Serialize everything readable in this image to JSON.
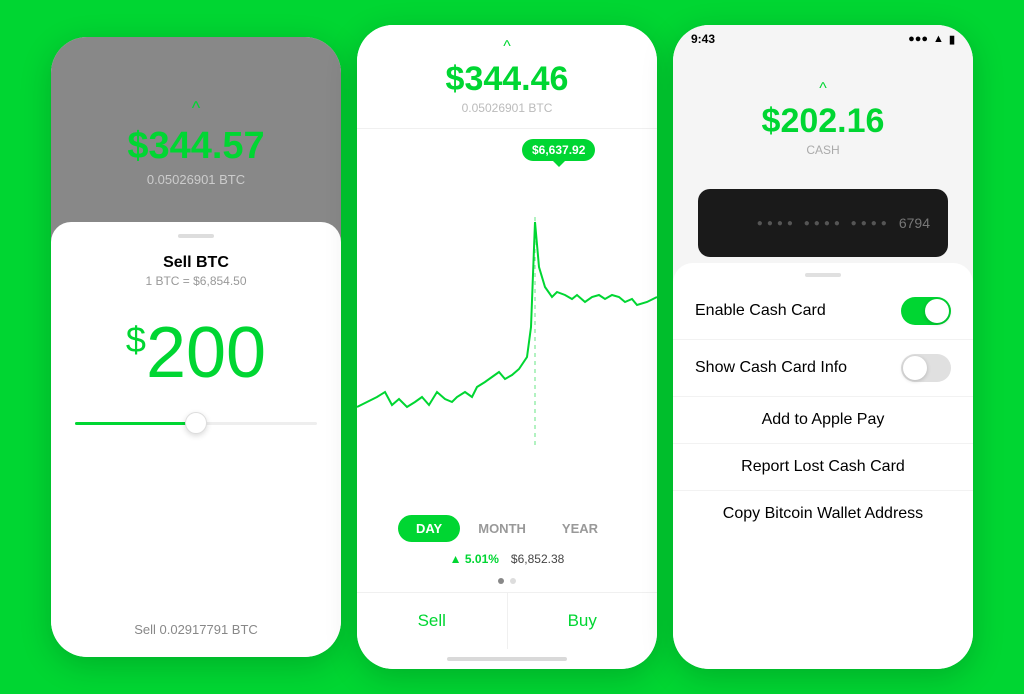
{
  "screens": {
    "phone1": {
      "top": {
        "caret": "^",
        "amount": "$344.57",
        "sub": "0.05026901 BTC"
      },
      "sheet": {
        "title": "Sell BTC",
        "rate": "1 BTC = $6,854.50",
        "amount": "$200",
        "amount_dollar": "$",
        "amount_number": "200",
        "bottom_label": "Sell 0.02917791 BTC"
      }
    },
    "phone2": {
      "top": {
        "caret": "^",
        "amount": "$344.46",
        "sub": "0.05026901 BTC"
      },
      "chart": {
        "tooltip": "$6,637.92"
      },
      "periods": [
        {
          "label": "DAY",
          "active": true
        },
        {
          "label": "MONTH",
          "active": false
        },
        {
          "label": "YEAR",
          "active": false
        }
      ],
      "stats": {
        "pct": "▲ 5.01%",
        "value": "$6,852.38"
      },
      "actions": {
        "sell": "Sell",
        "buy": "Buy"
      }
    },
    "phone3": {
      "statusBar": {
        "time": "9:43",
        "signal": "▲ ●●●",
        "wifi": "wifi",
        "battery": "■"
      },
      "top": {
        "caret": "^",
        "amount": "$202.16",
        "sub": "CASH"
      },
      "card": {
        "dots": "●●●● ●●●● ●●●●",
        "number": "6794"
      },
      "sheet": {
        "handle": "",
        "rows": [
          {
            "label": "Enable Cash Card",
            "type": "toggle",
            "value": true
          },
          {
            "label": "Show Cash Card Info",
            "type": "toggle",
            "value": false
          },
          {
            "label": "Add to Apple Pay",
            "type": "action"
          },
          {
            "label": "Report Lost Cash Card",
            "type": "action"
          },
          {
            "label": "Copy Bitcoin Wallet Address",
            "type": "action"
          }
        ]
      }
    }
  }
}
